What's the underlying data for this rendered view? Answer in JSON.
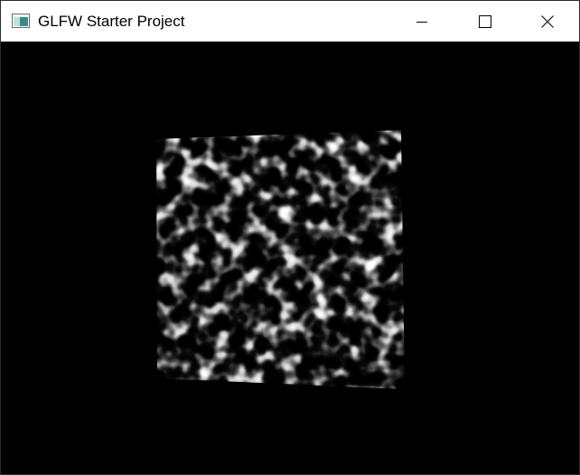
{
  "window": {
    "title": "GLFW Starter Project",
    "icon": "app-window-icon",
    "controls": {
      "minimize_icon": "minimize-icon",
      "maximize_icon": "maximize-icon",
      "close_icon": "close-icon"
    }
  },
  "colors": {
    "titlebar_bg": "#ffffff",
    "client_bg": "#000000",
    "title_text": "#000000"
  },
  "viewport": {
    "content": "noise-texture-quad"
  }
}
